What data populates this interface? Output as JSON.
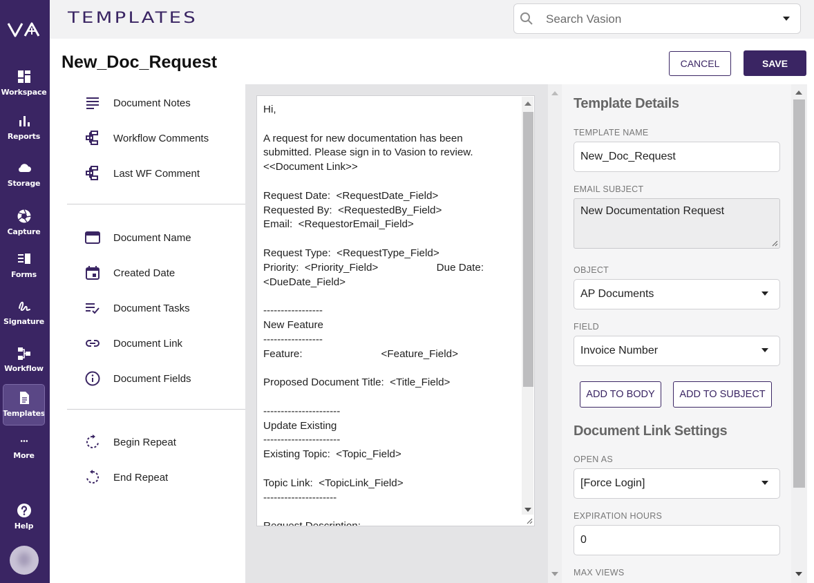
{
  "app": {
    "title": "TEMPLATES"
  },
  "search": {
    "placeholder": "Search Vasion"
  },
  "nav": {
    "items": [
      {
        "label": "Workspace",
        "icon": "workspace-icon"
      },
      {
        "label": "Reports",
        "icon": "reports-icon"
      },
      {
        "label": "Storage",
        "icon": "cloud-icon"
      },
      {
        "label": "Capture",
        "icon": "aperture-icon"
      },
      {
        "label": "Forms",
        "icon": "forms-icon"
      },
      {
        "label": "Signature",
        "icon": "signature-icon"
      },
      {
        "label": "Workflow",
        "icon": "workflow-icon"
      },
      {
        "label": "Templates",
        "icon": "document-icon",
        "active": true
      },
      {
        "label": "More",
        "icon": "more-icon"
      },
      {
        "label": "Help",
        "icon": "help-icon"
      }
    ]
  },
  "page": {
    "title": "New_Doc_Request",
    "cancel_label": "CANCEL",
    "save_label": "SAVE"
  },
  "field_list": {
    "group1": [
      "Document Notes",
      "Workflow Comments",
      "Last WF Comment"
    ],
    "group2": [
      "Document Name",
      "Created Date",
      "Document Tasks",
      "Document Link",
      "Document Fields"
    ],
    "group3": [
      "Begin Repeat",
      "End Repeat"
    ]
  },
  "body_text": "Hi,\n\nA request for new documentation has been\nsubmitted. Please sign in to Vasion to review.\n<<Document Link>>\n\nRequest Date:  <RequestDate_Field>\nRequested By:  <RequestedBy_Field>\nEmail:  <RequestorEmail_Field>\n\nRequest Type:  <RequestType_Field>\nPriority:  <Priority_Field>                    Due Date:\n<DueDate_Field>\n\n-----------------\nNew Feature\n-----------------\nFeature:                           <Feature_Field>\n\nProposed Document Title:  <Title_Field>\n\n----------------------\nUpdate Existing\n----------------------\nExisting Topic:  <Topic_Field>\n\nTopic Link:  <TopicLink_Field>\n---------------------\n\nRequest Description:",
  "details": {
    "heading": "Template Details",
    "template_name_label": "TEMPLATE NAME",
    "template_name_value": "New_Doc_Request",
    "email_subject_label": "EMAIL SUBJECT",
    "email_subject_value": "New Documentation Request",
    "object_label": "OBJECT",
    "object_value": "AP Documents",
    "field_label": "FIELD",
    "field_value": "Invoice Number",
    "add_body_label": "ADD TO BODY",
    "add_subject_label": "ADD TO SUBJECT"
  },
  "link_settings": {
    "heading": "Document Link Settings",
    "open_as_label": "OPEN AS",
    "open_as_value": "[Force Login]",
    "expiration_label": "EXPIRATION HOURS",
    "expiration_value": "0",
    "max_views_label": "MAX VIEWS"
  },
  "colors": {
    "brand": "#3a2563",
    "nav_active": "#5a4786"
  }
}
